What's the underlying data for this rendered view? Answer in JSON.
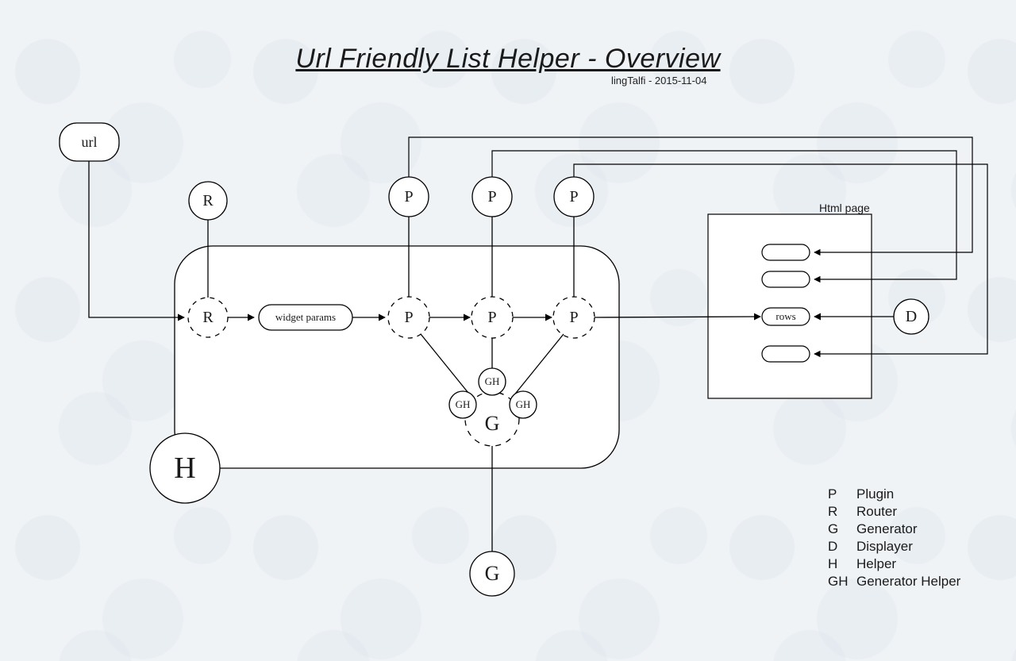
{
  "title": "Url Friendly List Helper  -  Overview",
  "subtitle": "lingTalfi - 2015-11-04",
  "nodes": {
    "url": "url",
    "R_top": "R",
    "R_in": "R",
    "widget_params": "widget params",
    "P_top1": "P",
    "P_top2": "P",
    "P_top3": "P",
    "P_in1": "P",
    "P_in2": "P",
    "P_in3": "P",
    "GH1": "GH",
    "GH2": "GH",
    "GH3": "GH",
    "G_in": "G",
    "G_bottom": "G",
    "H": "H",
    "D": "D",
    "rows": "rows"
  },
  "html_page_label": "Html page",
  "legend": [
    {
      "key": "P",
      "label": "Plugin"
    },
    {
      "key": "R",
      "label": "Router"
    },
    {
      "key": "G",
      "label": "Generator"
    },
    {
      "key": "D",
      "label": "Displayer"
    },
    {
      "key": "H",
      "label": "Helper"
    },
    {
      "key": "GH",
      "label": "Generator Helper"
    }
  ]
}
